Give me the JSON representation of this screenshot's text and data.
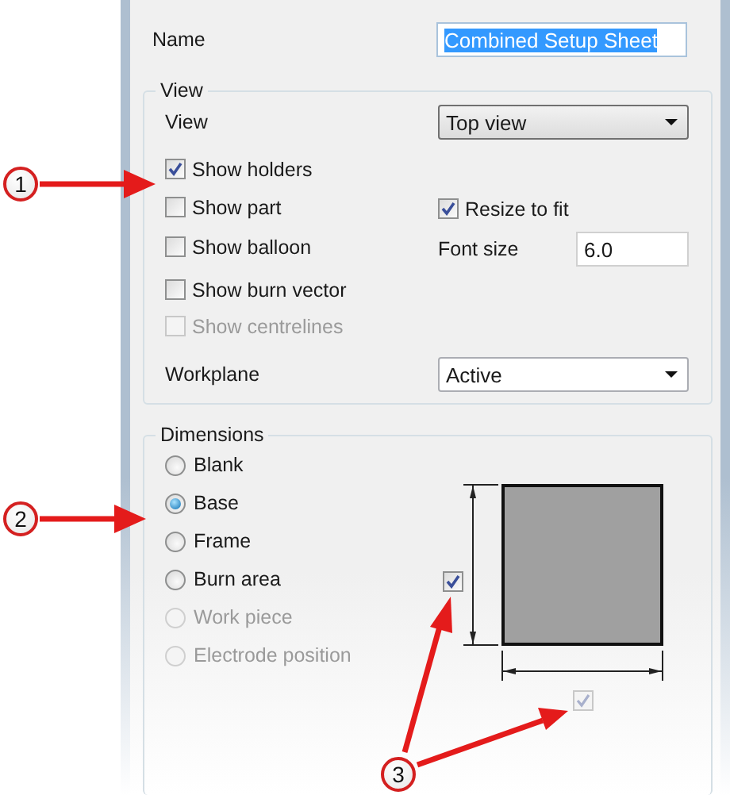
{
  "name_field": {
    "label": "Name",
    "value": "Combined Setup Sheet",
    "selected": true
  },
  "view_group": {
    "title": "View",
    "view": {
      "label": "View",
      "value": "Top view"
    },
    "options": [
      {
        "label": "Show holders",
        "checked": true,
        "disabled": false
      },
      {
        "label": "Show part",
        "checked": false,
        "disabled": false
      },
      {
        "label": "Show balloon",
        "checked": false,
        "disabled": false
      },
      {
        "label": "Show burn vector",
        "checked": false,
        "disabled": false
      },
      {
        "label": "Show centrelines",
        "checked": false,
        "disabled": true
      }
    ],
    "resize_to_fit": {
      "label": "Resize to fit",
      "checked": true,
      "disabled": false
    },
    "font_size": {
      "label": "Font size",
      "value": "6.0"
    },
    "workplane": {
      "label": "Workplane",
      "value": "Active"
    }
  },
  "dimensions_group": {
    "title": "Dimensions",
    "options": [
      {
        "label": "Blank",
        "selected": false,
        "disabled": false
      },
      {
        "label": "Base",
        "selected": true,
        "disabled": false
      },
      {
        "label": "Frame",
        "selected": false,
        "disabled": false
      },
      {
        "label": "Burn area",
        "selected": false,
        "disabled": false
      },
      {
        "label": "Work piece",
        "selected": false,
        "disabled": true
      },
      {
        "label": "Electrode position",
        "selected": false,
        "disabled": true
      }
    ],
    "height_dimension": {
      "checked": true,
      "disabled": false
    },
    "width_dimension": {
      "checked": true,
      "disabled": true
    }
  },
  "callouts": [
    {
      "number": "1"
    },
    {
      "number": "2"
    },
    {
      "number": "3"
    }
  ]
}
